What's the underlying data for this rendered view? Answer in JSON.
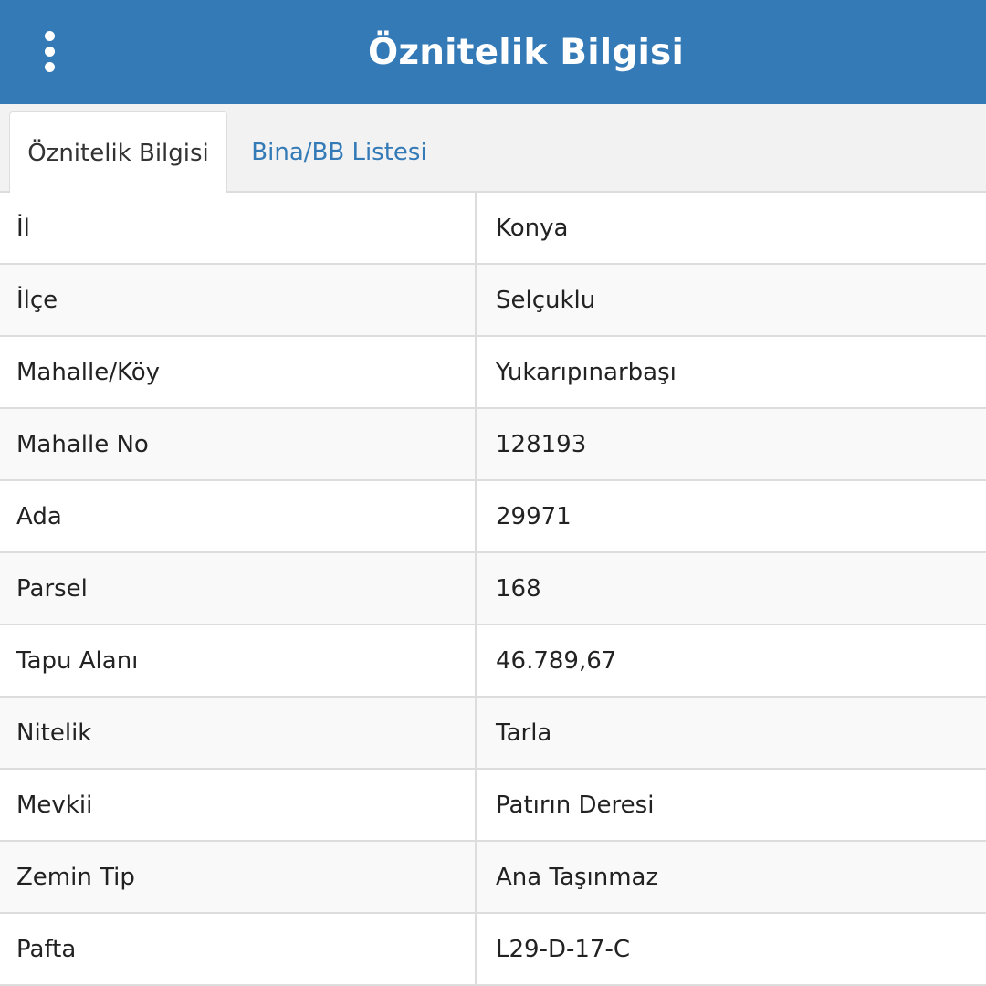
{
  "header": {
    "title": "Öznitelik Bilgisi",
    "menu_icon": "vertical-ellipsis-icon"
  },
  "tabs": [
    {
      "label": "Öznitelik Bilgisi",
      "active": true
    },
    {
      "label": "Bina/BB Listesi",
      "active": false
    }
  ],
  "attributes": [
    {
      "key": "İl",
      "value": "Konya"
    },
    {
      "key": "İlçe",
      "value": "Selçuklu"
    },
    {
      "key": "Mahalle/Köy",
      "value": "Yukarıpınarbaşı"
    },
    {
      "key": "Mahalle No",
      "value": "128193"
    },
    {
      "key": "Ada",
      "value": "29971"
    },
    {
      "key": "Parsel",
      "value": "168"
    },
    {
      "key": "Tapu Alanı",
      "value": "46.789,67"
    },
    {
      "key": "Nitelik",
      "value": "Tarla"
    },
    {
      "key": "Mevkii",
      "value": "Patırın Deresi"
    },
    {
      "key": "Zemin Tip",
      "value": "Ana Taşınmaz"
    },
    {
      "key": "Pafta",
      "value": "L29-D-17-C"
    }
  ],
  "colors": {
    "header_bg": "#337ab7",
    "link": "#337ab7",
    "border": "#dddddd",
    "row_alt": "#f9f9f9"
  }
}
